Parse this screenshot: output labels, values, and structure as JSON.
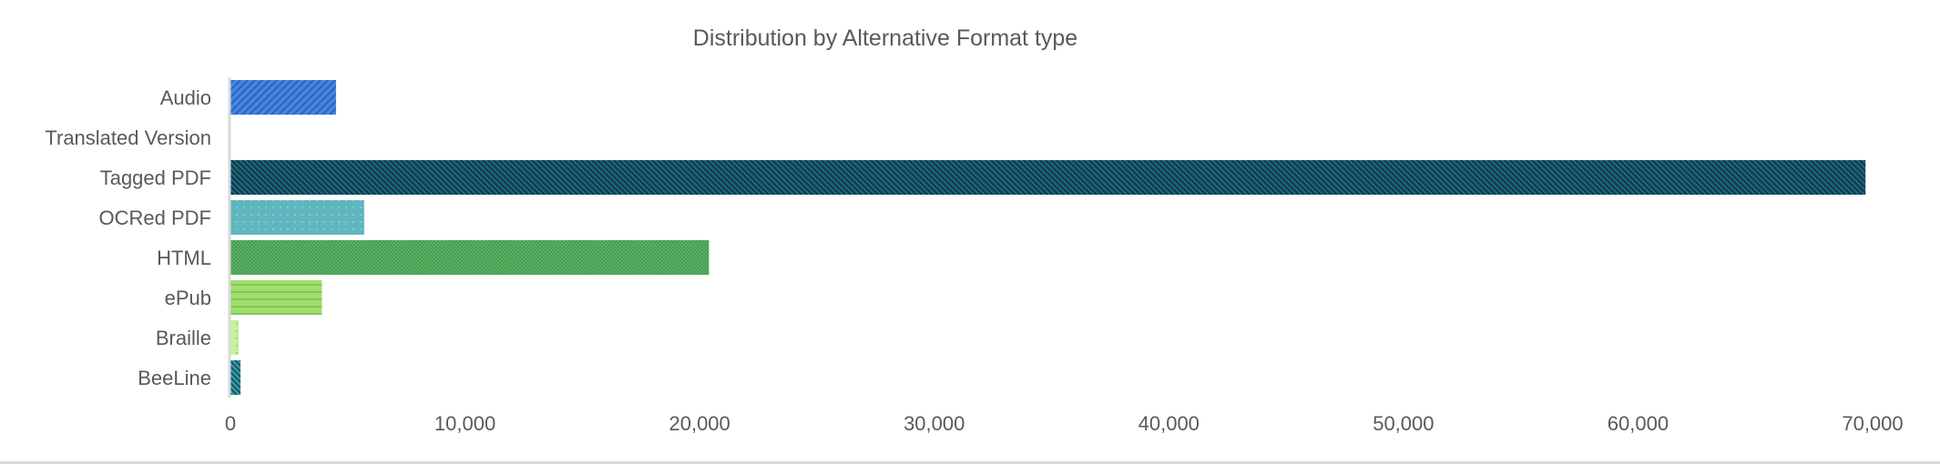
{
  "chart_data": {
    "type": "bar",
    "orientation": "horizontal",
    "title": "Distribution by Alternative Format type",
    "xlabel": "",
    "ylabel": "",
    "categories": [
      "Audio",
      "Translated Version",
      "Tagged PDF",
      "OCRed PDF",
      "HTML",
      "ePub",
      "Braille",
      "BeeLine"
    ],
    "values": [
      4500,
      0,
      69700,
      5700,
      20400,
      3900,
      350,
      430
    ],
    "xlim": [
      0,
      70000
    ],
    "xticks": [
      0,
      10000,
      20000,
      30000,
      40000,
      50000,
      60000,
      70000
    ],
    "xtick_labels": [
      "0",
      "10,000",
      "20,000",
      "30,000",
      "40,000",
      "50,000",
      "60,000",
      "70,000"
    ],
    "grid": false,
    "legend": "none",
    "bar_styles": [
      {
        "fill": "#4386e6",
        "pattern_color": "#2f62b4",
        "pattern": "forward-diagonal"
      },
      {
        "fill": "#4386e6",
        "pattern_color": "#2f62b4",
        "pattern": "none"
      },
      {
        "fill": "#0e6f84",
        "pattern_color": "#1f3447",
        "pattern": "backward-diagonal"
      },
      {
        "fill": "#62b5bd",
        "pattern_color": "#5fd8e6",
        "pattern": "dots"
      },
      {
        "fill": "#57b35f",
        "pattern_color": "#4a9a55",
        "pattern": "checker"
      },
      {
        "fill": "#9fe06a",
        "pattern_color": "#86c260",
        "pattern": "horizontal"
      },
      {
        "fill": "#c8f0a0",
        "pattern_color": "#9fd878",
        "pattern": "dots"
      },
      {
        "fill": "#4a9aa6",
        "pattern_color": "#0b5f6e",
        "pattern": "backward-diagonal"
      }
    ],
    "axis_color": "#d9d9d9",
    "text_color": "#595959"
  }
}
